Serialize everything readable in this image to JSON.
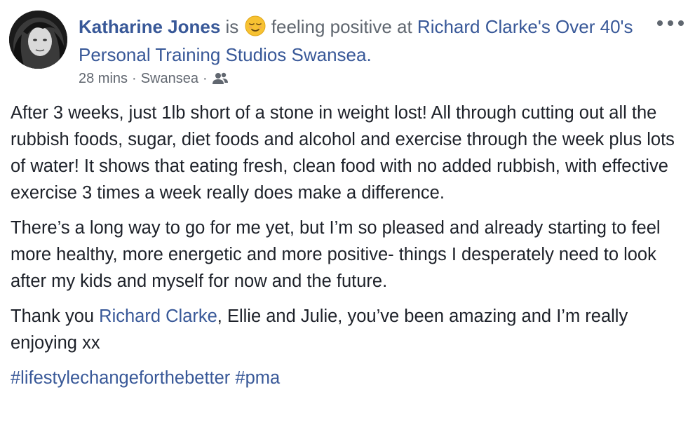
{
  "post": {
    "actor_name": "Katharine Jones",
    "verb_is": "is",
    "feeling_text": "feeling positive at",
    "place": "Richard Clarke's Over 40's Personal Training Studios Swansea.",
    "meta": {
      "time": "28 mins",
      "separator": "·",
      "location": "Swansea",
      "audience_icon": "friends-icon"
    },
    "paragraphs": [
      "After 3 weeks, just 1lb short of a stone in weight lost! All through cutting out all the rubbish foods, sugar, diet foods and alcohol and exercise through the week plus lots of water! It shows that eating fresh, clean food with no added rubbish, with effective exercise 3 times a week really does make a difference.",
      "There’s a long way to go for me yet, but I’m so pleased and already starting to feel more healthy, more energetic and more positive- things I desperately need to look after my kids and myself for now and the future."
    ],
    "thanks": {
      "before": "Thank you ",
      "mention": "Richard Clarke",
      "after": ", Ellie and Julie, you’ve been amazing and I’m really enjoying xx"
    },
    "hashtags": [
      "#lifestylechangeforthebetter",
      "#pma"
    ]
  },
  "colors": {
    "link": "#385898",
    "text": "#1d2129",
    "secondary": "#606770"
  },
  "icons": {
    "more": "more-options-icon",
    "emoji": "relieved-face-emoji"
  }
}
